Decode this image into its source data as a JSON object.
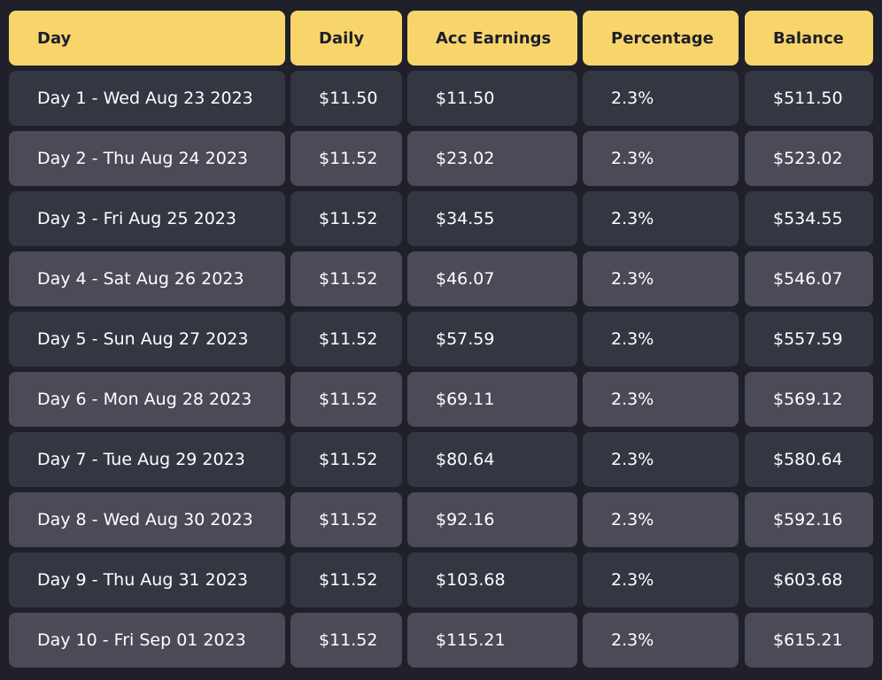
{
  "table": {
    "headers": [
      "Day",
      "Daily",
      "Acc Earnings",
      "Percentage",
      "Balance"
    ],
    "rows": [
      [
        "Day 1 - Wed Aug 23 2023",
        "$11.50",
        "$11.50",
        "2.3%",
        "$511.50"
      ],
      [
        "Day 2 - Thu Aug 24 2023",
        "$11.52",
        "$23.02",
        "2.3%",
        "$523.02"
      ],
      [
        "Day 3 - Fri Aug 25 2023",
        "$11.52",
        "$34.55",
        "2.3%",
        "$534.55"
      ],
      [
        "Day 4 - Sat Aug 26 2023",
        "$11.52",
        "$46.07",
        "2.3%",
        "$546.07"
      ],
      [
        "Day 5 - Sun Aug 27 2023",
        "$11.52",
        "$57.59",
        "2.3%",
        "$557.59"
      ],
      [
        "Day 6 - Mon Aug 28 2023",
        "$11.52",
        "$69.11",
        "2.3%",
        "$569.12"
      ],
      [
        "Day 7 - Tue Aug 29 2023",
        "$11.52",
        "$80.64",
        "2.3%",
        "$580.64"
      ],
      [
        "Day 8 - Wed Aug 30 2023",
        "$11.52",
        "$92.16",
        "2.3%",
        "$592.16"
      ],
      [
        "Day 9 - Thu Aug 31 2023",
        "$11.52",
        "$103.68",
        "2.3%",
        "$603.68"
      ],
      [
        "Day 10 - Fri Sep 01 2023",
        "$11.52",
        "$115.21",
        "2.3%",
        "$615.21"
      ]
    ]
  },
  "colors": {
    "page_background": "#1f2029",
    "header_background": "#f8d56b",
    "header_text": "#1d1f2a",
    "row_dark": "#343641",
    "row_light": "#4a4b57",
    "cell_text": "#ffffff"
  }
}
